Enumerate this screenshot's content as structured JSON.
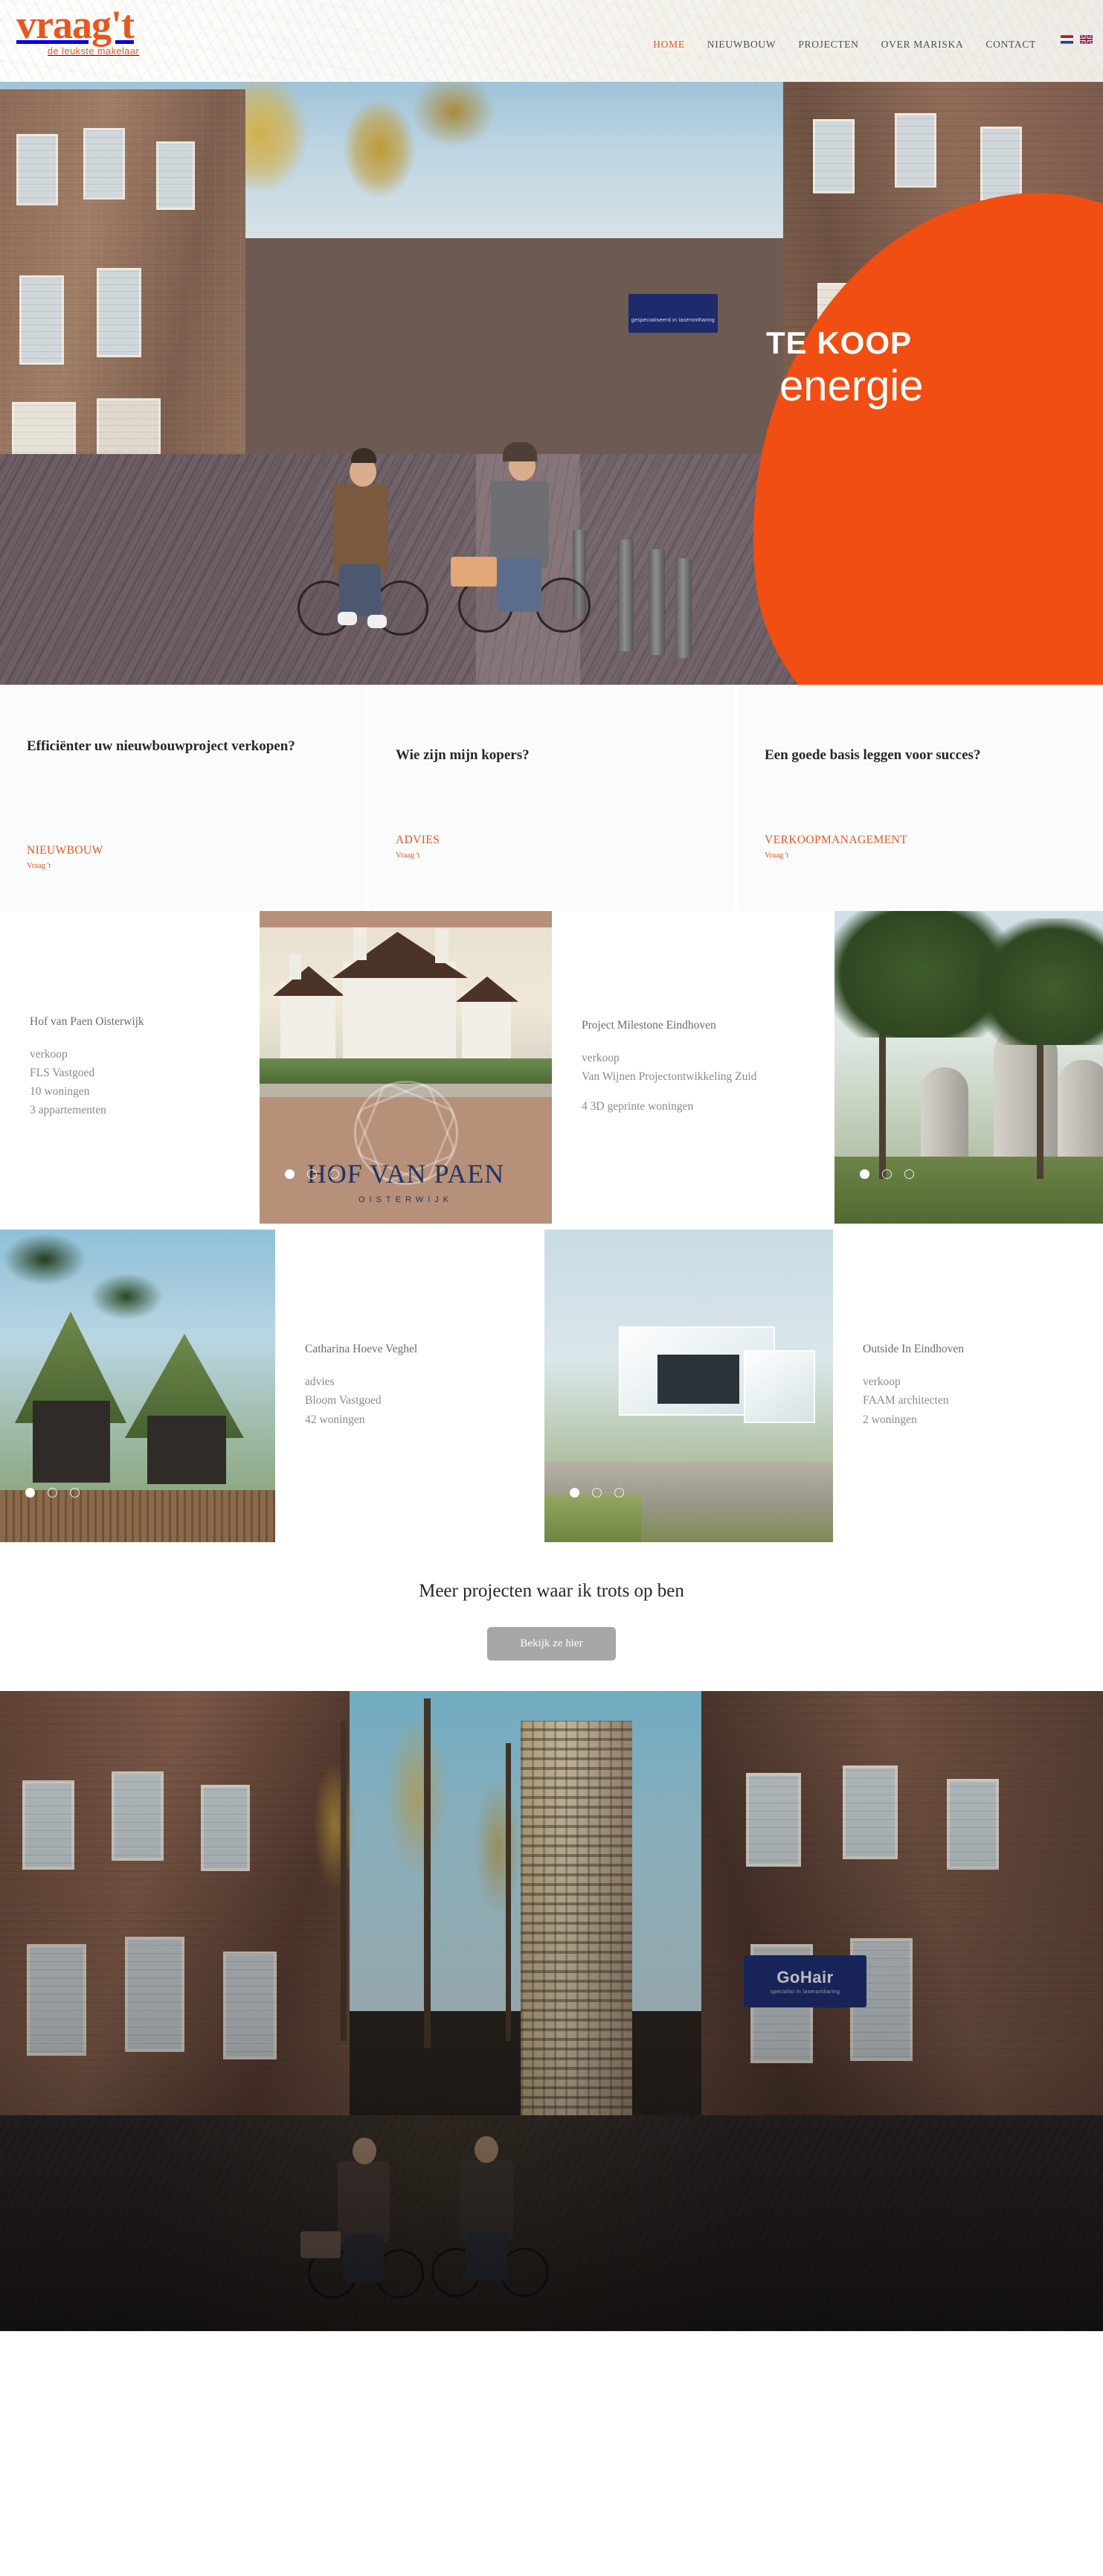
{
  "brand": {
    "logo_text": "vraag't",
    "tagline": "de leukste makelaar",
    "accent_color": "#e8561f",
    "hero_blob_color": "#f04e12"
  },
  "nav": {
    "items": [
      {
        "label": "HOME",
        "active": true
      },
      {
        "label": "NIEUWBOUW",
        "active": false
      },
      {
        "label": "PROJECTEN",
        "active": false
      },
      {
        "label": "OVER MARISKA",
        "active": false
      },
      {
        "label": "CONTACT",
        "active": false
      }
    ],
    "languages": [
      {
        "name": "nl-flag-icon",
        "label": "Nederlands"
      },
      {
        "name": "en-flag-icon",
        "label": "English"
      }
    ]
  },
  "hero": {
    "badge_title": "TE KOOP",
    "badge_subtitle": "energie",
    "sign_text": "gespecialiseerd in laserontharing",
    "carousel": {
      "total": 3,
      "active": 1
    }
  },
  "services": [
    {
      "title": "Efficiënter uw nieuwbouwproject verkopen?",
      "category": "NIEUWBOUW",
      "sub": "Vraag 't"
    },
    {
      "title": "Wie zijn mijn kopers?",
      "category": "ADVIES",
      "sub": "Vraag 't"
    },
    {
      "title": "Een goede basis leggen voor succes?",
      "category": "VERKOOPMANAGEMENT",
      "sub": "Vraag 't"
    }
  ],
  "projects": [
    {
      "title": "Hof van Paen Oisterwijk",
      "service": "verkoop",
      "client": "FLS Vastgoed",
      "units": "10 woningen",
      "extra": "3 appartementen",
      "image_brand_name": "HOF VAN PAEN",
      "image_brand_city": "OISTERWIJK",
      "carousel": {
        "total": 3,
        "active": 1
      }
    },
    {
      "title": "Project Milestone Eindhoven",
      "service": "verkoop",
      "client": "Van Wijnen Projectontwikkeling Zuid",
      "units": "4 3D geprinte woningen",
      "extra": "",
      "carousel": {
        "total": 3,
        "active": 1
      }
    },
    {
      "title": "Catharina Hoeve Veghel",
      "service": "advies",
      "client": "Bloom Vastgoed",
      "units": "42 woningen",
      "extra": "",
      "carousel": {
        "total": 3,
        "active": 1
      }
    },
    {
      "title": "Outside In Eindhoven",
      "service": "verkoop",
      "client": "FAAM architecten",
      "units": "2 woningen",
      "extra": "",
      "carousel": {
        "total": 3,
        "active": 1
      }
    }
  ],
  "cta": {
    "title": "Meer projecten waar ik trots op ben",
    "button_label": "Bekijk ze hier"
  },
  "bottom_hero": {
    "sign_big": "GoHair",
    "sign_small": "specialist in laserontharing"
  }
}
